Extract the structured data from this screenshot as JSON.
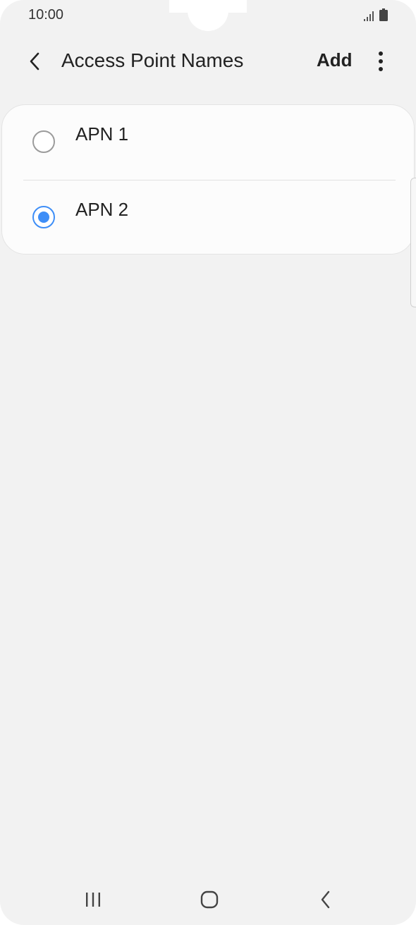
{
  "status_bar": {
    "time": "10:00",
    "icons": [
      "signal-icon",
      "battery-icon"
    ]
  },
  "app_bar": {
    "title": "Access Point Names",
    "add_label": "Add",
    "icons": [
      "back-arrow-icon",
      "more-options-icon"
    ]
  },
  "apn_list": {
    "items": [
      {
        "label": "APN 1",
        "selected": false
      },
      {
        "label": "APN 2",
        "selected": true
      }
    ]
  },
  "colors": {
    "accent": "#3e8ef7",
    "background": "#f2f2f2",
    "card": "#fcfcfc",
    "text": "#222222"
  },
  "nav_bar": {
    "icons": [
      "recents-icon",
      "home-icon",
      "back-icon"
    ]
  }
}
